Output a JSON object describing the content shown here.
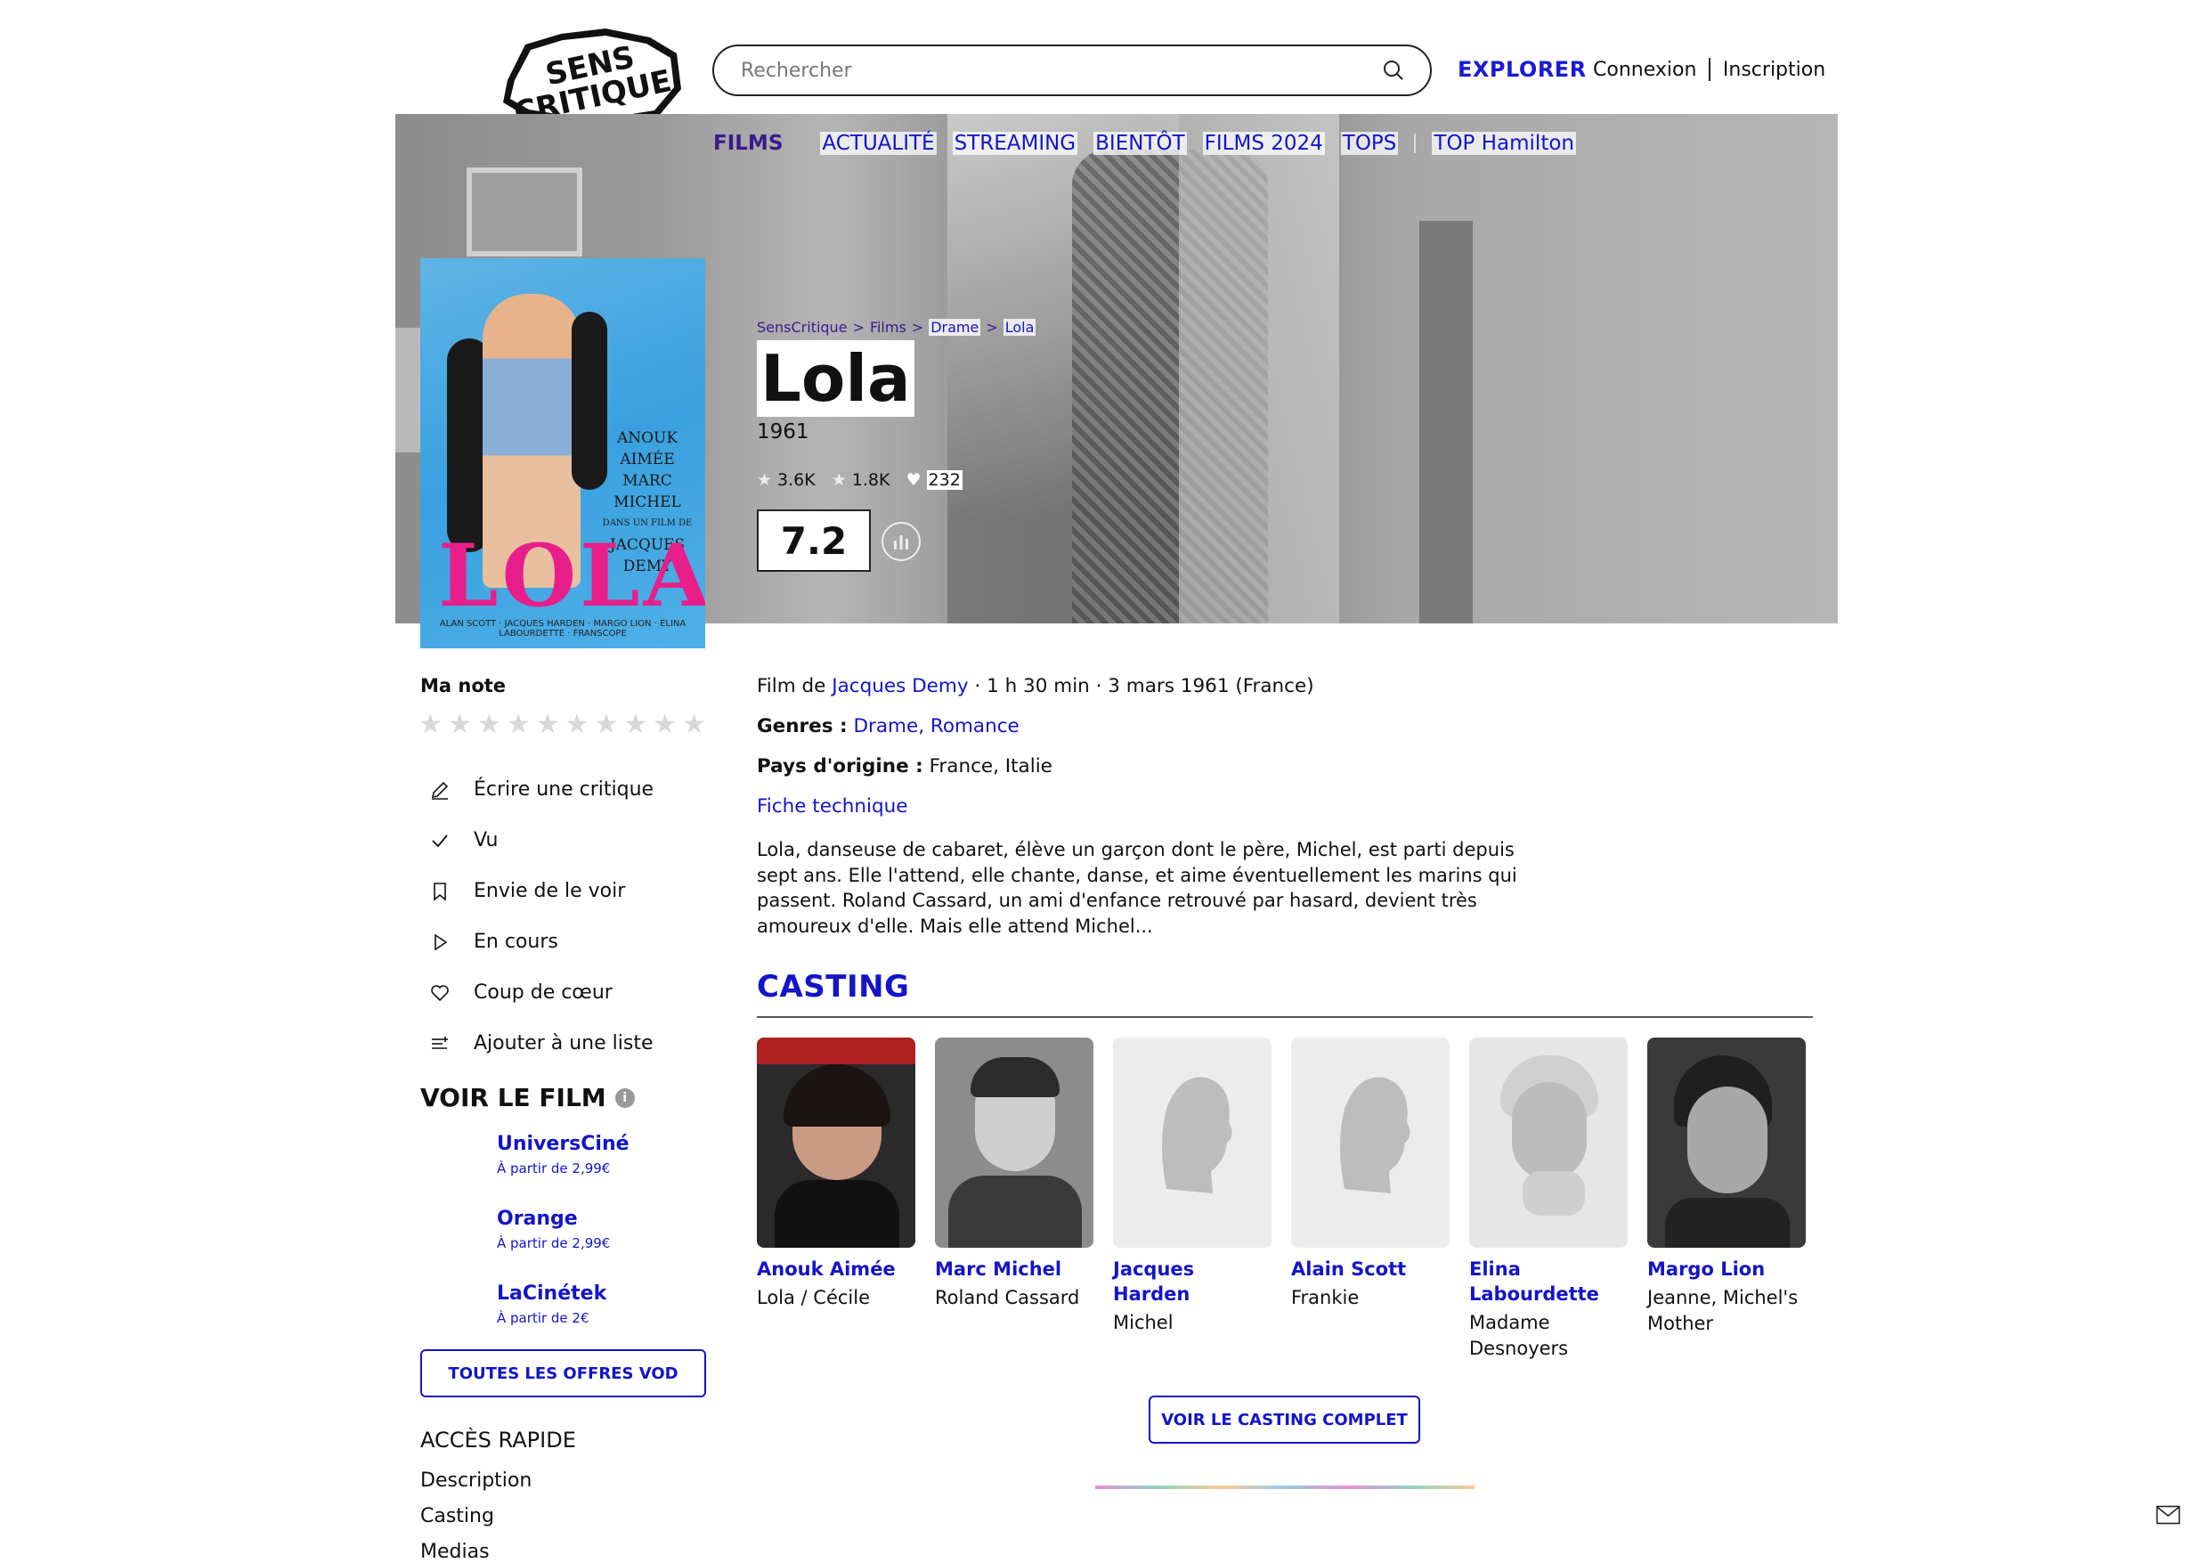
{
  "header": {
    "logo_text_top": "SENS",
    "logo_text_bottom": "CRITIQUE",
    "search_placeholder": "Rechercher",
    "explorer_label": "EXPLORER",
    "login_label": "Connexion",
    "signup_label": "Inscription"
  },
  "subnav": {
    "films_label": "FILMS",
    "items": [
      "ACTUALITÉ",
      "STREAMING",
      "BIENTÔT",
      "FILMS 2024",
      "TOPS",
      "TOP Hamilton"
    ]
  },
  "poster": {
    "names": [
      "ANOUK AIMÉE",
      "MARC MICHEL",
      "DANS UN FILM DE",
      "JACQUES DEMY"
    ],
    "title": "LOLA",
    "credits": "ALAN SCOTT · JACQUES HARDEN · MARGO LION · ELINA LABOURDETTE · FRANSCOPE"
  },
  "breadcrumb": [
    "SensCritique",
    "Films",
    "Drame",
    "Lola"
  ],
  "movie": {
    "title": "Lola",
    "year": "1961",
    "stats": {
      "seen": "3.6K",
      "wish": "1.8K",
      "likes": "232"
    },
    "rating": "7.2"
  },
  "my_rating": {
    "label": "Ma note",
    "max_stars": 10
  },
  "actions": [
    {
      "icon": "pencil-icon",
      "label": "Écrire une critique"
    },
    {
      "icon": "check-icon",
      "label": "Vu"
    },
    {
      "icon": "bookmark-icon",
      "label": "Envie de le voir"
    },
    {
      "icon": "play-icon",
      "label": "En cours"
    },
    {
      "icon": "heart-icon",
      "label": "Coup de cœur"
    },
    {
      "icon": "list-add-icon",
      "label": "Ajouter à une liste"
    }
  ],
  "voir_le_film": {
    "title": "VOIR LE FILM",
    "offers": [
      {
        "name": "UniversCiné",
        "price": "À partir de 2,99€"
      },
      {
        "name": "Orange",
        "price": "À partir de 2,99€"
      },
      {
        "name": "LaCinétek",
        "price": "À partir de 2€"
      }
    ],
    "all_offers_button": "TOUTES LES OFFRES VOD"
  },
  "acces_rapide": {
    "title": "ACCÈS RAPIDE",
    "items": [
      "Description",
      "Casting",
      "Medias"
    ]
  },
  "details": {
    "film_de_prefix": "Film de",
    "director": "Jacques Demy",
    "duration_date": " · 1 h 30 min · 3 mars 1961 (France)",
    "genres_label": "Genres :",
    "genres": "Drame, Romance",
    "pays_label": "Pays d'origine :",
    "pays": "France, Italie",
    "fiche_technique": "Fiche technique",
    "synopsis": "Lola, danseuse de cabaret, élève un garçon dont le père, Michel, est parti depuis sept ans. Elle l'attend, elle chante, danse, et aime éventuellement les marins qui passent. Roland Cassard, un ami d'enfance retrouvé par hasard, devient très amoureux d'elle. Mais elle attend Michel..."
  },
  "casting": {
    "title": "CASTING",
    "members": [
      {
        "name": "Anouk Aimée",
        "role": "Lola / Cécile",
        "photo": "portrait"
      },
      {
        "name": "Marc Michel",
        "role": "Roland Cassard",
        "photo": "portrait"
      },
      {
        "name": "Jacques Harden",
        "role": "Michel",
        "photo": "placeholder"
      },
      {
        "name": "Alain Scott",
        "role": "Frankie",
        "photo": "placeholder"
      },
      {
        "name": "Elina Labourdette",
        "role": "Madame Desnoyers",
        "photo": "portrait"
      },
      {
        "name": "Margo Lion",
        "role": "Jeanne, Michel's Mother",
        "photo": "portrait"
      }
    ],
    "full_casting_button": "VOIR LE CASTING COMPLET"
  },
  "colors": {
    "accent_blue": "#1414c8",
    "films_purple": "#3a1a8c",
    "text": "#111111",
    "star_empty": "#d8d8d8",
    "poster_pink": "#e81f8a"
  }
}
